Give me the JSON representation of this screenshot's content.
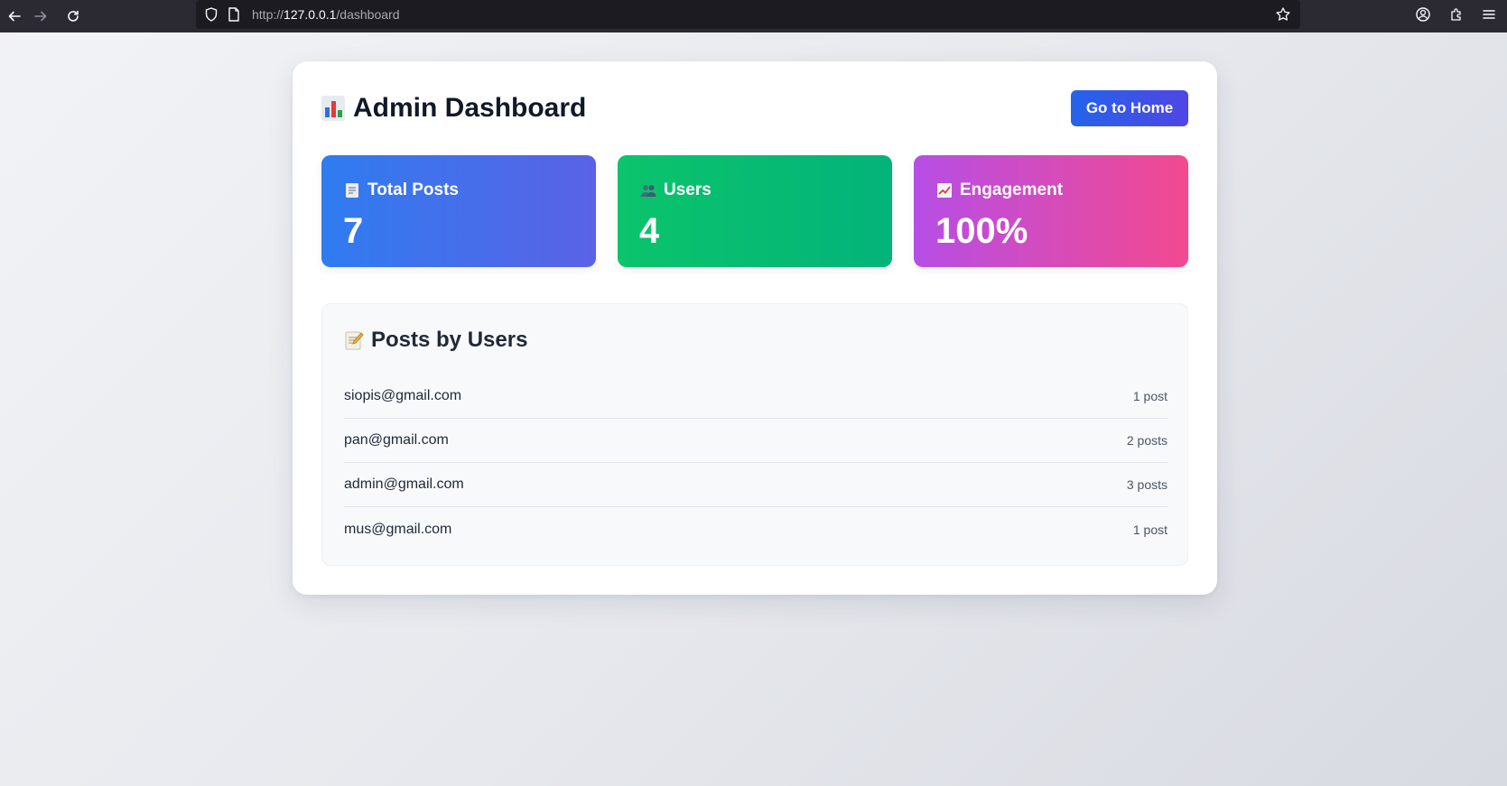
{
  "browser": {
    "url_scheme": "http://",
    "url_host": "127.0.0.1",
    "url_path": "/dashboard"
  },
  "header": {
    "title": "Admin Dashboard",
    "title_icon": "bar-chart-icon",
    "home_button_label": "Go to Home"
  },
  "stats": [
    {
      "label": "Total Posts",
      "value": "7",
      "icon": "document-icon",
      "color_from": "#2f7cf0",
      "color_to": "#5a62e6"
    },
    {
      "label": "Users",
      "value": "4",
      "icon": "users-icon",
      "color_from": "#0bc46b",
      "color_to": "#03b37a"
    },
    {
      "label": "Engagement",
      "value": "100%",
      "icon": "trend-up-icon",
      "color_from": "#b64ee6",
      "color_to": "#f3498f"
    }
  ],
  "posts_by_users": {
    "title": "Posts by Users",
    "title_icon": "memo-icon",
    "rows": [
      {
        "email": "siopis@gmail.com",
        "count": "1 post"
      },
      {
        "email": "pan@gmail.com",
        "count": "2 posts"
      },
      {
        "email": "admin@gmail.com",
        "count": "3 posts"
      },
      {
        "email": "mus@gmail.com",
        "count": "1 post"
      }
    ]
  },
  "colors": {
    "accent": "#2563eb",
    "title_text": "#111827",
    "chrome_bg": "#2b2a33"
  }
}
